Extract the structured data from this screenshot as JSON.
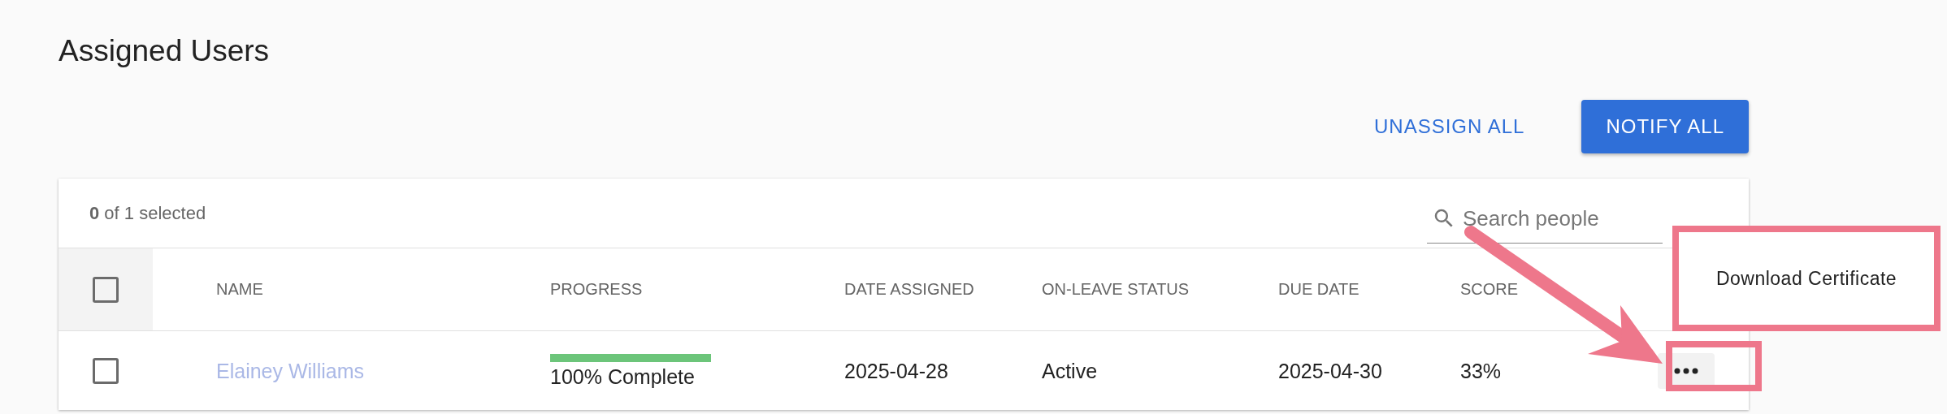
{
  "title": "Assigned Users",
  "actions": [
    {
      "label": "UNASSIGN ALL",
      "kind": "text"
    },
    {
      "label": "NOTIFY ALL",
      "kind": "contained"
    }
  ],
  "table": {
    "selection": "**0** of 1 selected",
    "search": {
      "placeholder": "Search people"
    },
    "select_all": {
      "checked": false
    },
    "columns": [
      "NAME",
      "PROGRESS",
      "DATE ASSIGNED",
      "ON-LEAVE STATUS",
      "DUE DATE",
      "SCORE"
    ],
    "rows": [
      {
        "checked": false,
        "name": "Elainey Williams",
        "progress": {
          "level": 1,
          "label": "100% Complete"
        },
        "date_assigned": "2025-04-28",
        "on_leave_status": "Active",
        "due_date": "2025-04-30",
        "score": "33%"
      }
    ]
  },
  "row_menu": {
    "items": [
      "Download Certificate"
    ]
  }
}
